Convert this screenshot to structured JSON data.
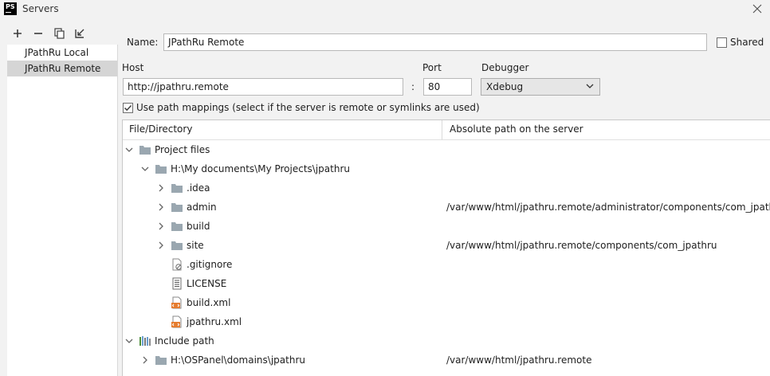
{
  "window": {
    "title": "Servers",
    "app_icon": "PS"
  },
  "toolbar": {
    "add": "add-icon",
    "remove": "remove-icon",
    "copy": "copy-icon",
    "import": "import-icon"
  },
  "servers": [
    {
      "label": "JPathRu Local",
      "selected": false
    },
    {
      "label": "JPathRu Remote",
      "selected": true
    }
  ],
  "form": {
    "name_label": "Name:",
    "name_value": "JPathRu Remote",
    "shared_label": "Shared",
    "shared_checked": false,
    "host_label": "Host",
    "host_value": "http://jpathru.remote",
    "colon": ":",
    "port_label": "Port",
    "port_value": "80",
    "debugger_label": "Debugger",
    "debugger_value": "Xdebug",
    "use_mappings_label": "Use path mappings (select if the server is remote or symlinks are used)",
    "use_mappings_checked": true
  },
  "table": {
    "col1": "File/Directory",
    "col2": "Absolute path on the server",
    "rows": [
      {
        "name": "Project files",
        "path": ""
      },
      {
        "name": "H:\\My documents\\My Projects\\jpathru",
        "path": ""
      },
      {
        "name": ".idea",
        "path": ""
      },
      {
        "name": "admin",
        "path": "/var/www/html/jpathru.remote/administrator/components/com_jpathru"
      },
      {
        "name": "build",
        "path": ""
      },
      {
        "name": "site",
        "path": "/var/www/html/jpathru.remote/components/com_jpathru"
      },
      {
        "name": ".gitignore",
        "path": ""
      },
      {
        "name": "LICENSE",
        "path": ""
      },
      {
        "name": "build.xml",
        "path": ""
      },
      {
        "name": "jpathru.xml",
        "path": ""
      },
      {
        "name": "Include path",
        "path": ""
      },
      {
        "name": "H:\\OSPanel\\domains\\jpathru",
        "path": "/var/www/html/jpathru.remote"
      }
    ]
  },
  "colors": {
    "selection": "#d5d5d5",
    "folder": "#9aa7b0",
    "xml": "#e57c2f",
    "check": "#3c3c3c"
  }
}
